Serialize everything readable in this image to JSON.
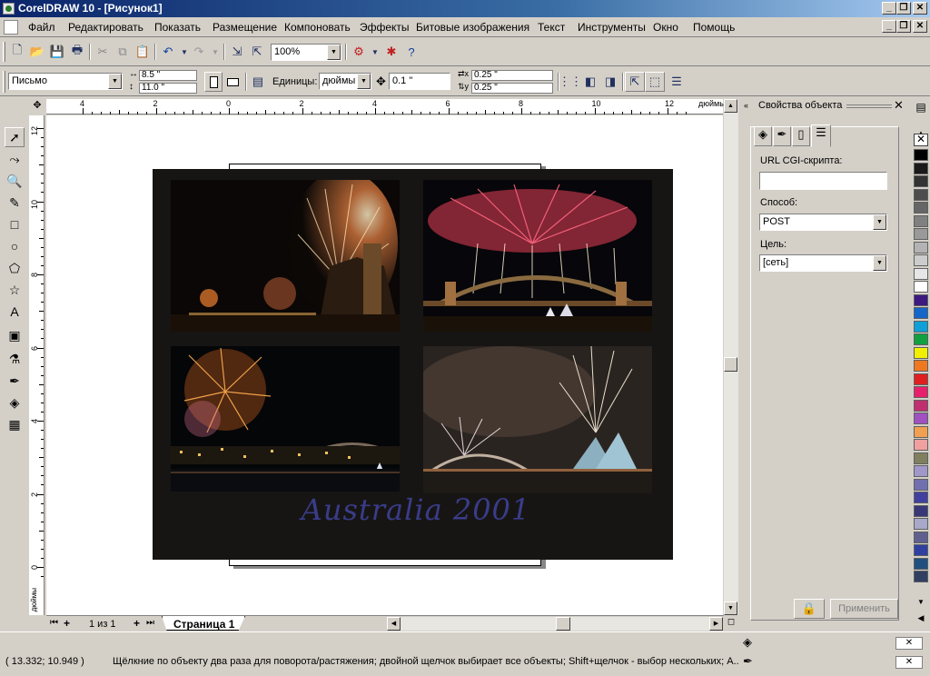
{
  "window": {
    "title": "CorelDRAW 10 - [Рисунок1]",
    "controls": [
      "_",
      "❐",
      "✕"
    ],
    "doc_controls": [
      "_",
      "❐",
      "✕"
    ]
  },
  "menu": [
    "Файл",
    "Редактировать",
    "Показать",
    "Размещение",
    "Компоновать",
    "Эффекты",
    "Битовые изображения",
    "Текст",
    "Инструменты",
    "Окно",
    "Помощь"
  ],
  "standard_toolbar": {
    "zoom": "100%"
  },
  "property_bar": {
    "paper_size": "Письмо",
    "width": "8.5 \"",
    "height": "11.0 \"",
    "units_label": "Единицы:",
    "units_value": "дюймы",
    "nudge": "0.1 \"",
    "dup_x": "0.25 \"",
    "dup_y": "0.25 \""
  },
  "rulers": {
    "units": "дюймы",
    "h_ticks": [
      "4",
      "2",
      "0",
      "2",
      "4",
      "6",
      "8",
      "10",
      "12"
    ],
    "v_ticks": [
      "12",
      "10",
      "8",
      "6",
      "4",
      "2",
      "0"
    ]
  },
  "document": {
    "artwork_title": "Australia 2001"
  },
  "page_nav": {
    "count": "1 из 1",
    "tab": "Страница 1"
  },
  "docker": {
    "title": "Свойства объекта",
    "url_label": "URL CGI-скрипта:",
    "url_value": "",
    "method_label": "Способ:",
    "method_value": "POST",
    "target_label": "Цель:",
    "target_value": "[сеть]",
    "apply": "Применить"
  },
  "palette": {
    "colors": [
      "#000000",
      "#1a1a1a",
      "#333333",
      "#4d4d4d",
      "#666666",
      "#808080",
      "#999999",
      "#b3b3b3",
      "#cccccc",
      "#e6e6e6",
      "#ffffff",
      "#3c1a80",
      "#1466c8",
      "#10a0d8",
      "#10a040",
      "#f0f000",
      "#f07820",
      "#e02020",
      "#e8206c",
      "#c03070",
      "#a050c0",
      "#f0a050",
      "#f0a0a0",
      "#808060",
      "#a098c8",
      "#7070b0",
      "#4040a0",
      "#383878",
      "#a8a8c8",
      "#606090",
      "#3040a0",
      "#205080",
      "#304060"
    ]
  },
  "status": {
    "coords": "( 13.332; 10.949 )",
    "message": "Щёлкние по объекту два раза для поворота/растяжения; двойной щелчок выбирает все объекты; Shift+щелчок - выбор нескольких; A..."
  }
}
